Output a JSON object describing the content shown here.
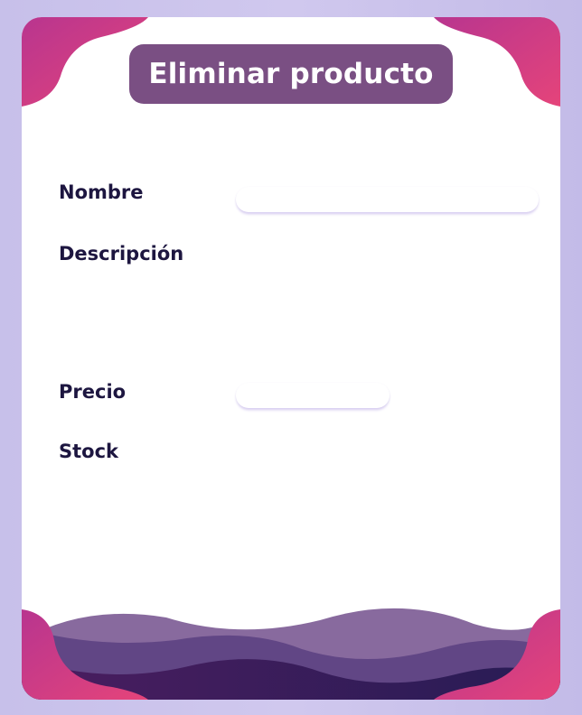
{
  "form": {
    "title": "Eliminar producto",
    "fields": {
      "nombre": {
        "label": "Nombre",
        "value": ""
      },
      "descripcion": {
        "label": "Descripción",
        "value": ""
      },
      "precio": {
        "label": "Precio",
        "value": ""
      },
      "stock": {
        "label": "Stock",
        "value": ""
      }
    }
  },
  "colors": {
    "background": "#c7c0ea",
    "card": "#ffffff",
    "title_pill": "#7a4f83",
    "label_text": "#1d1640",
    "accent_pink": "#e03f7d",
    "accent_magenta": "#9b2d8c",
    "wave_dark": "#2a1352"
  }
}
